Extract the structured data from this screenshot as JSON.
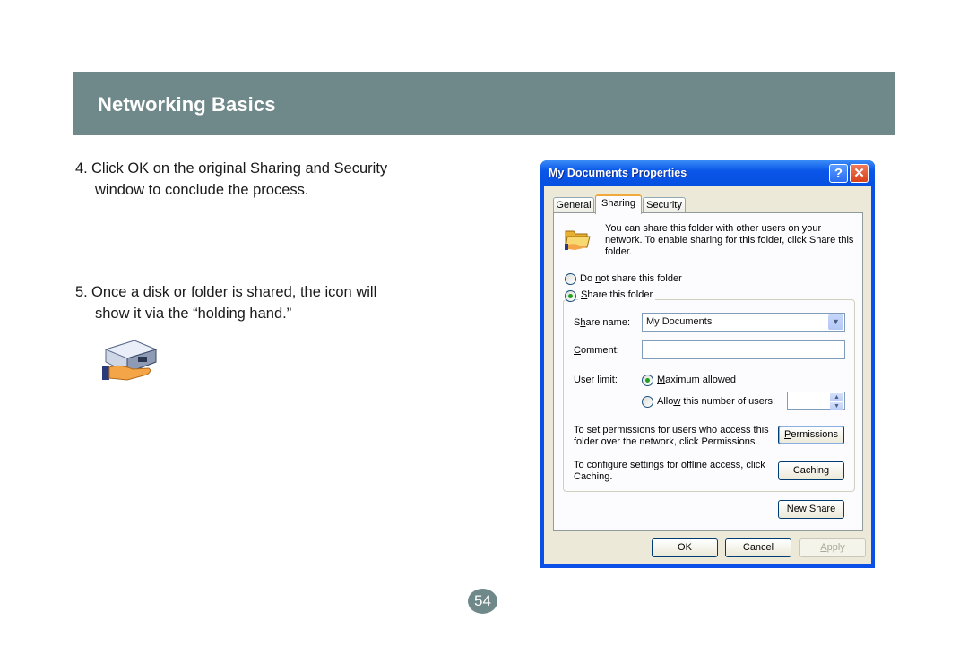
{
  "header": {
    "title": "Networking Basics",
    "band_color": "#6f8889"
  },
  "steps": [
    {
      "number": "4.",
      "line1": "Click OK on the original Sharing and Security",
      "line2": "window to conclude the process."
    },
    {
      "number": "5.",
      "line1": "Once a disk or folder is shared, the icon will",
      "line2": "show it via the “holding hand.”"
    }
  ],
  "shared_icon": "shared-drive-holding-hand-icon",
  "dialog": {
    "title": "My Documents Properties",
    "help_label": "?",
    "close_label": "✕",
    "tabs": [
      {
        "label": "General",
        "active": false
      },
      {
        "label": "Sharing",
        "active": true
      },
      {
        "label": "Security",
        "active": false
      }
    ],
    "intro": "You can share this folder with other users on your network.  To enable sharing for this folder, click Share this folder.",
    "radio_no_share": {
      "pre": "Do ",
      "accel": "n",
      "post": "ot share this folder",
      "selected": false
    },
    "radio_share": {
      "pre": "",
      "accel": "S",
      "post": "hare this folder",
      "selected": true
    },
    "share_name": {
      "label_pre": "S",
      "label_accel": "h",
      "label_post": "are name:",
      "value": "My Documents"
    },
    "comment": {
      "label_accel": "C",
      "label_post": "omment:",
      "value": ""
    },
    "user_limit": {
      "label": "User limit:",
      "max_allowed": {
        "accel": "M",
        "post": "aximum allowed",
        "selected": true
      },
      "allow_number": {
        "pre": "Allo",
        "accel": "w",
        "post": " this number of users:",
        "selected": false,
        "value": ""
      }
    },
    "permissions_text": "To set permissions for users who access this folder over the network, click Permissions.",
    "permissions_button": {
      "accel": "P",
      "post": "ermissions"
    },
    "caching_text": "To configure settings for offline access, click Caching.",
    "caching_button": "Caching",
    "new_share_button": {
      "pre": "N",
      "accel": "e",
      "post": "w Share"
    },
    "ok_button": "OK",
    "cancel_button": "Cancel",
    "apply_button": {
      "accel": "A",
      "post": "pply",
      "disabled": true
    }
  },
  "page_number": "54"
}
